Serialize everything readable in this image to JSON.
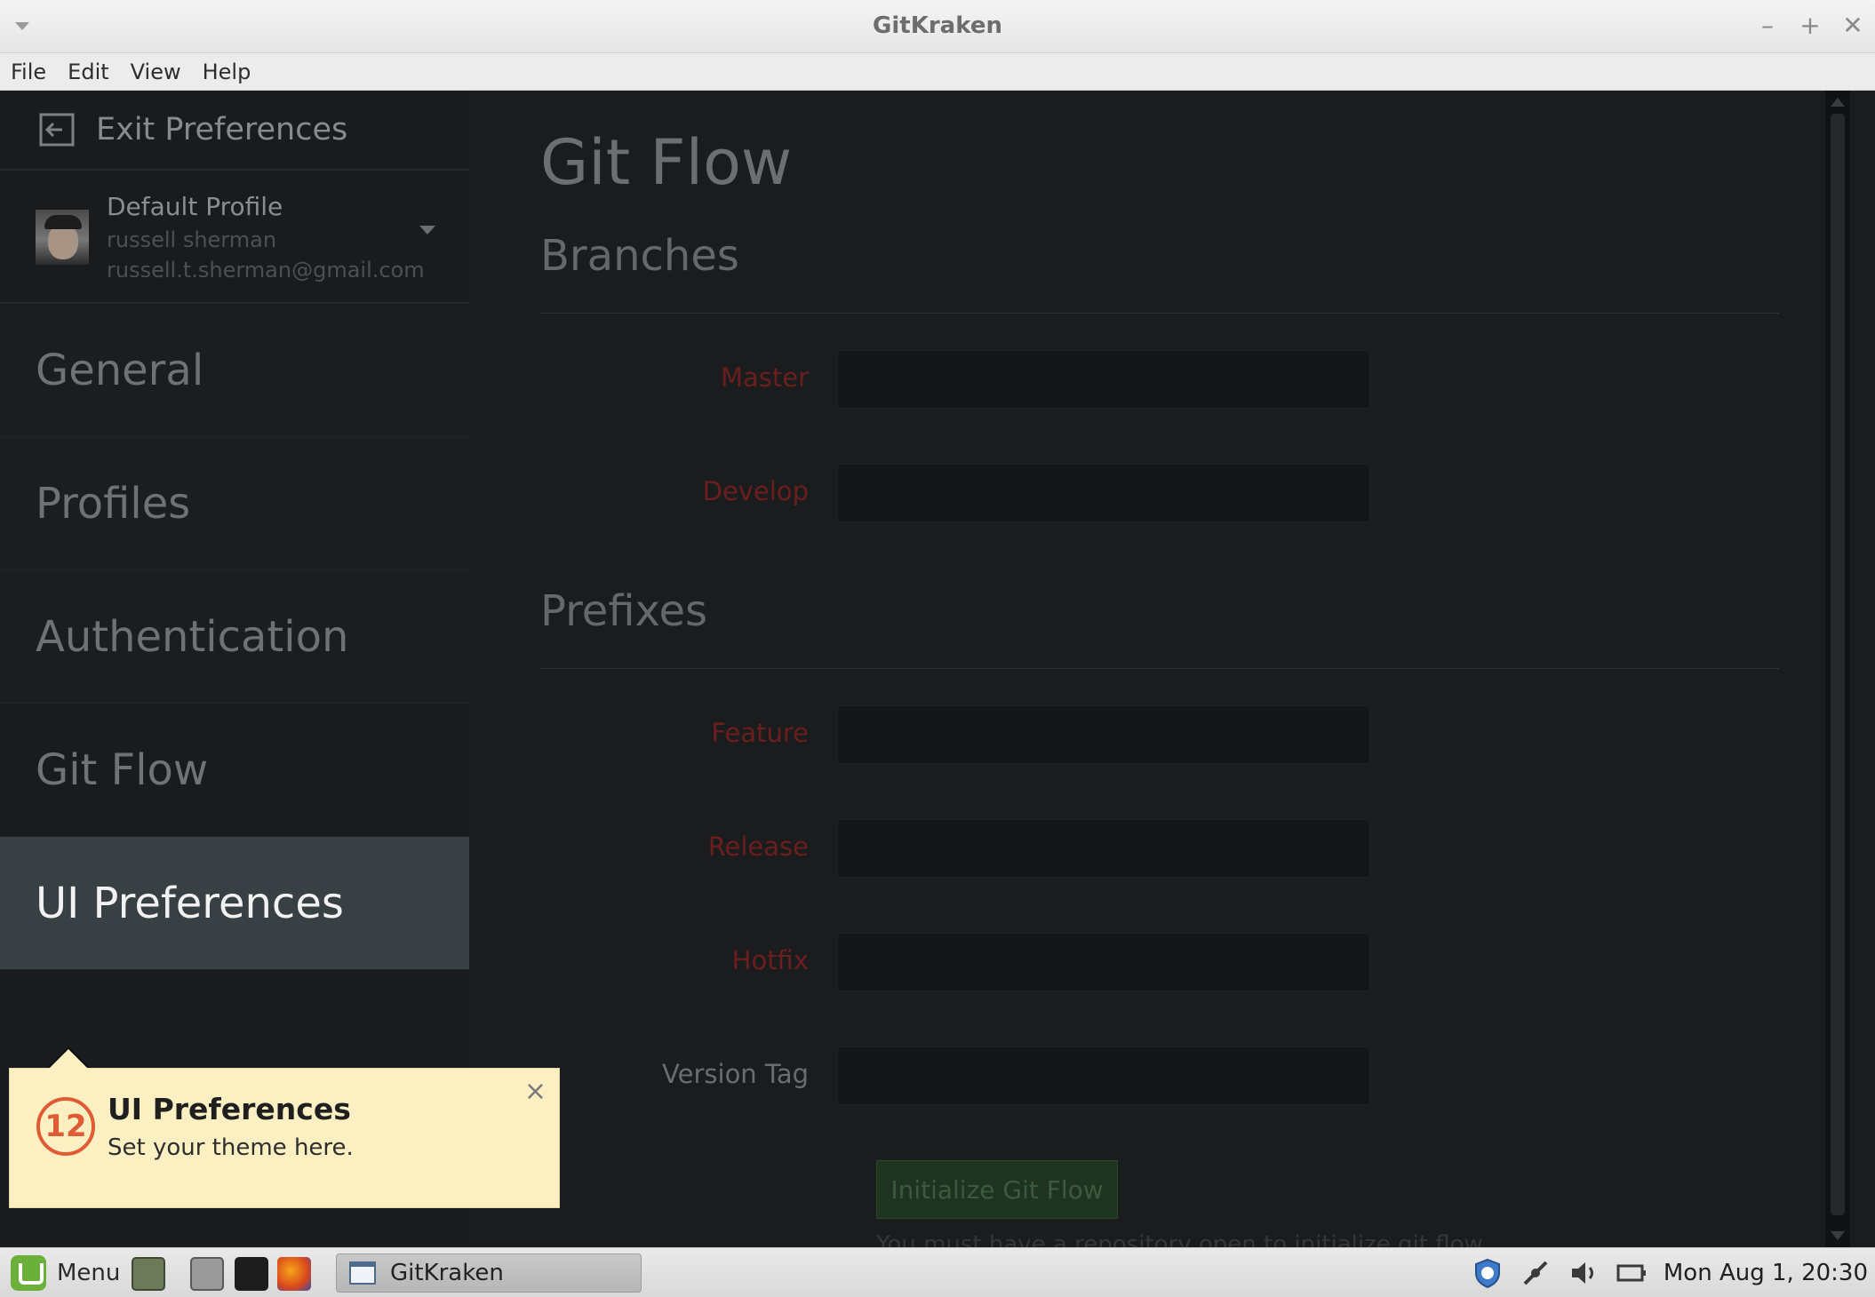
{
  "window": {
    "title": "GitKraken"
  },
  "menubar": {
    "items": [
      "File",
      "Edit",
      "View",
      "Help"
    ]
  },
  "sidebar": {
    "exit_label": "Exit Preferences",
    "profile": {
      "name": "Default Profile",
      "user": "russell sherman",
      "email": "russell.t.sherman@gmail.com"
    },
    "items": [
      "General",
      "Profiles",
      "Authentication",
      "Git Flow",
      "UI Preferences"
    ]
  },
  "content": {
    "title": "Git Flow",
    "branches_heading": "Branches",
    "master_label": "Master",
    "develop_label": "Develop",
    "prefixes_heading": "Prefixes",
    "feature_label": "Feature",
    "release_label": "Release",
    "hotfix_label": "Hotfix",
    "version_tag_label": "Version Tag",
    "init_button": "Initialize Git Flow",
    "note": "You must have a repository open to initialize git flow"
  },
  "tooltip": {
    "step": "12",
    "title": "UI Preferences",
    "subtitle": "Set your theme here.",
    "close": "×"
  },
  "taskbar": {
    "menu_label": "Menu",
    "window_label": "GitKraken",
    "clock": "Mon Aug  1, 20:30"
  },
  "colors": {
    "accent_orange": "#e05a33",
    "tooltip_bg": "#fcf0c2",
    "required_label": "#6b1e1e",
    "active_nav": "#384043"
  }
}
